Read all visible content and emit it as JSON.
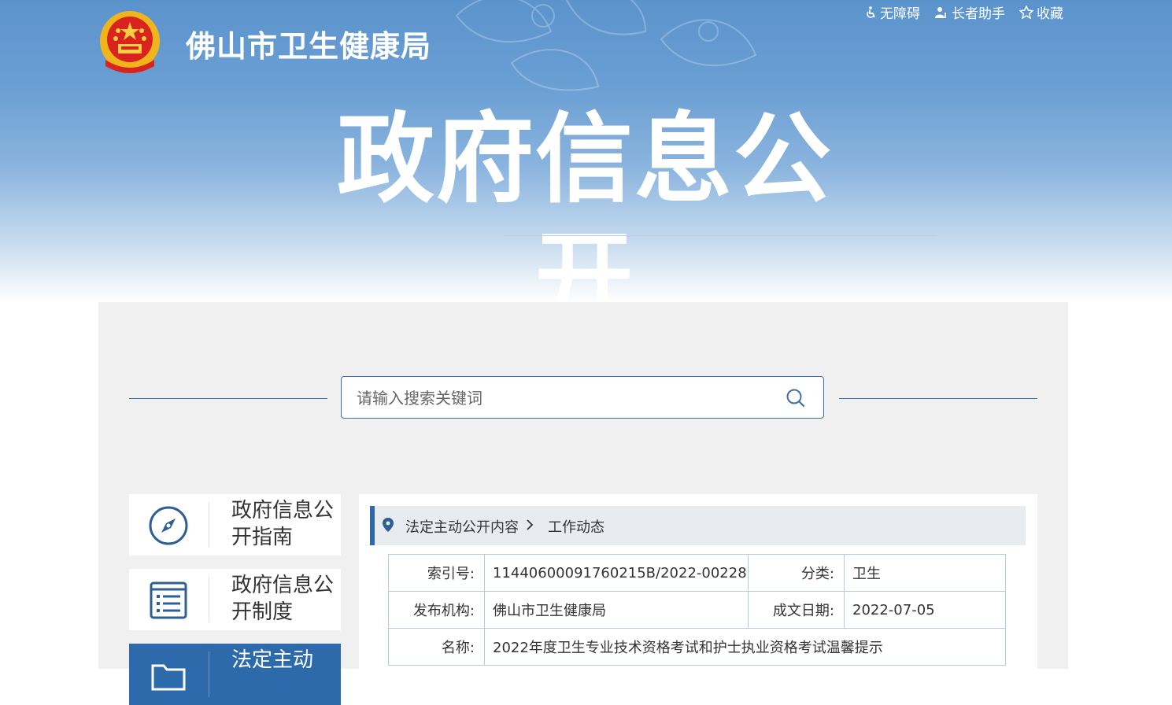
{
  "header": {
    "site_title": "佛山市卫生健康局",
    "hero_title": "政府信息公开",
    "links": [
      {
        "label": "无障碍",
        "icon": "wheelchair-icon"
      },
      {
        "label": "长者助手",
        "icon": "elder-helper-icon"
      },
      {
        "label": "收藏",
        "icon": "star-icon"
      }
    ]
  },
  "search": {
    "placeholder": "请输入搜索关键词"
  },
  "sidebar": {
    "items": [
      {
        "label": "政府信息公开指南",
        "icon": "compass-icon"
      },
      {
        "label": "政府信息公开制度",
        "icon": "document-list-icon"
      },
      {
        "label": "法定主动",
        "icon": "folder-icon"
      }
    ]
  },
  "breadcrumb": {
    "items": [
      "法定主动公开内容",
      "工作动态"
    ]
  },
  "info": {
    "index_label": "索引号:",
    "index_value": "11440600091760215B/2022-00228",
    "category_label": "分类:",
    "category_value": "卫生",
    "publisher_label": "发布机构:",
    "publisher_value": "佛山市卫生健康局",
    "date_label": "成文日期:",
    "date_value": "2022-07-05",
    "name_label": "名称:",
    "name_value": "2022年度卫生专业技术资格考试和护士执业资格考试温馨提示"
  },
  "colors": {
    "primary": "#2d6aab",
    "hero_top": "#5b93cc",
    "panel_bg": "#f0f0f1"
  }
}
